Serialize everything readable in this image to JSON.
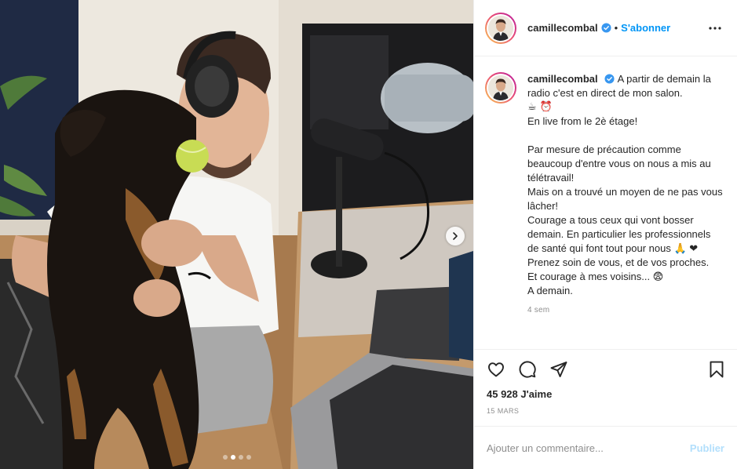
{
  "media": {
    "carousel_dots": 4,
    "active_dot": 1,
    "next_icon": "chevron-right-icon"
  },
  "header": {
    "username": "camillecombal",
    "separator": "•",
    "follow_label": "S'abonner",
    "more_icon": "more-horizontal-icon"
  },
  "caption": {
    "username": "camillecombal",
    "text": "A partir de demain la radio c'est en direct de mon salon.",
    "emoji_line": "☕ ⏰",
    "lines": [
      "En live from le 2è étage!",
      "",
      "Par mesure de précaution comme beaucoup d'entre vous on nous a mis au télétravail!",
      "Mais on a trouvé un moyen de ne pas vous lâcher!",
      "Courage a tous ceux qui vont bosser demain. En particulier les professionnels de santé qui font tout pour nous 🙏 ❤",
      "Prenez soin de vous, et de vos proches.",
      "Et courage à mes voisins... 😨",
      "A demain."
    ],
    "age": "4 sem"
  },
  "actions": {
    "like_icon": "heart-icon",
    "comment_icon": "comment-icon",
    "share_icon": "share-icon",
    "save_icon": "bookmark-icon"
  },
  "likes": "45 928 J'aime",
  "date": "15 MARS",
  "comment_box": {
    "placeholder": "Ajouter un commentaire...",
    "post_label": "Publier"
  },
  "colors": {
    "link_blue": "#0095f6",
    "post_disabled": "#b2dffc",
    "meta_grey": "#8e8e8e",
    "verified_blue": "#3897f0"
  }
}
